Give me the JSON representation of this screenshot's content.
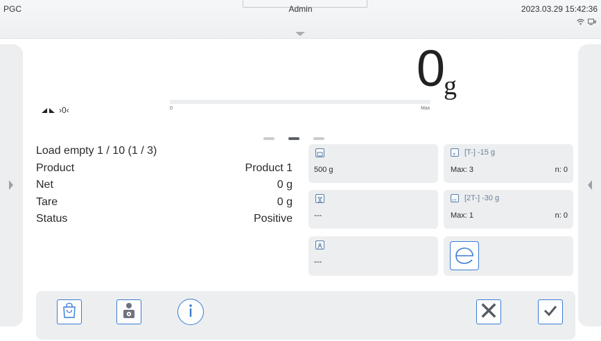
{
  "topbar": {
    "left": "PGC",
    "center": "Admin",
    "datetime": "2023.03.29 15:42:36",
    "icons": [
      "wifi-icon",
      "network-icon"
    ]
  },
  "display": {
    "weight": "0",
    "unit": "g",
    "zero_indicator": "›0‹",
    "bar_min": "0",
    "bar_max": "Max"
  },
  "pages": {
    "count": 3,
    "active": 2
  },
  "info": [
    {
      "label": "Load empty 1 / 10 (1 / 3)",
      "value": ""
    },
    {
      "label": "Product",
      "value": "Product 1"
    },
    {
      "label": "Net",
      "value": "0 g"
    },
    {
      "label": "Tare",
      "value": "0 g"
    },
    {
      "label": "Status",
      "value": "Positive"
    }
  ],
  "widgets": {
    "threshold": {
      "value": "500 g"
    },
    "timer": {
      "value": "---"
    },
    "weight_icon": {
      "value": "---"
    },
    "tare1": {
      "header": "[T-]   -15 g",
      "max": "Max: 3",
      "n": "n: 0"
    },
    "tare2": {
      "header": "[2T-]   -30 g",
      "max": "Max: 1",
      "n": "n: 0"
    }
  },
  "toolbar": {
    "buttons": [
      "product-bag-button",
      "operator-button",
      "info-button",
      "cancel-button",
      "confirm-button"
    ]
  },
  "colors": {
    "accent": "#3a7bd5",
    "panel": "#eceef0",
    "dark": "#5a5f66"
  }
}
